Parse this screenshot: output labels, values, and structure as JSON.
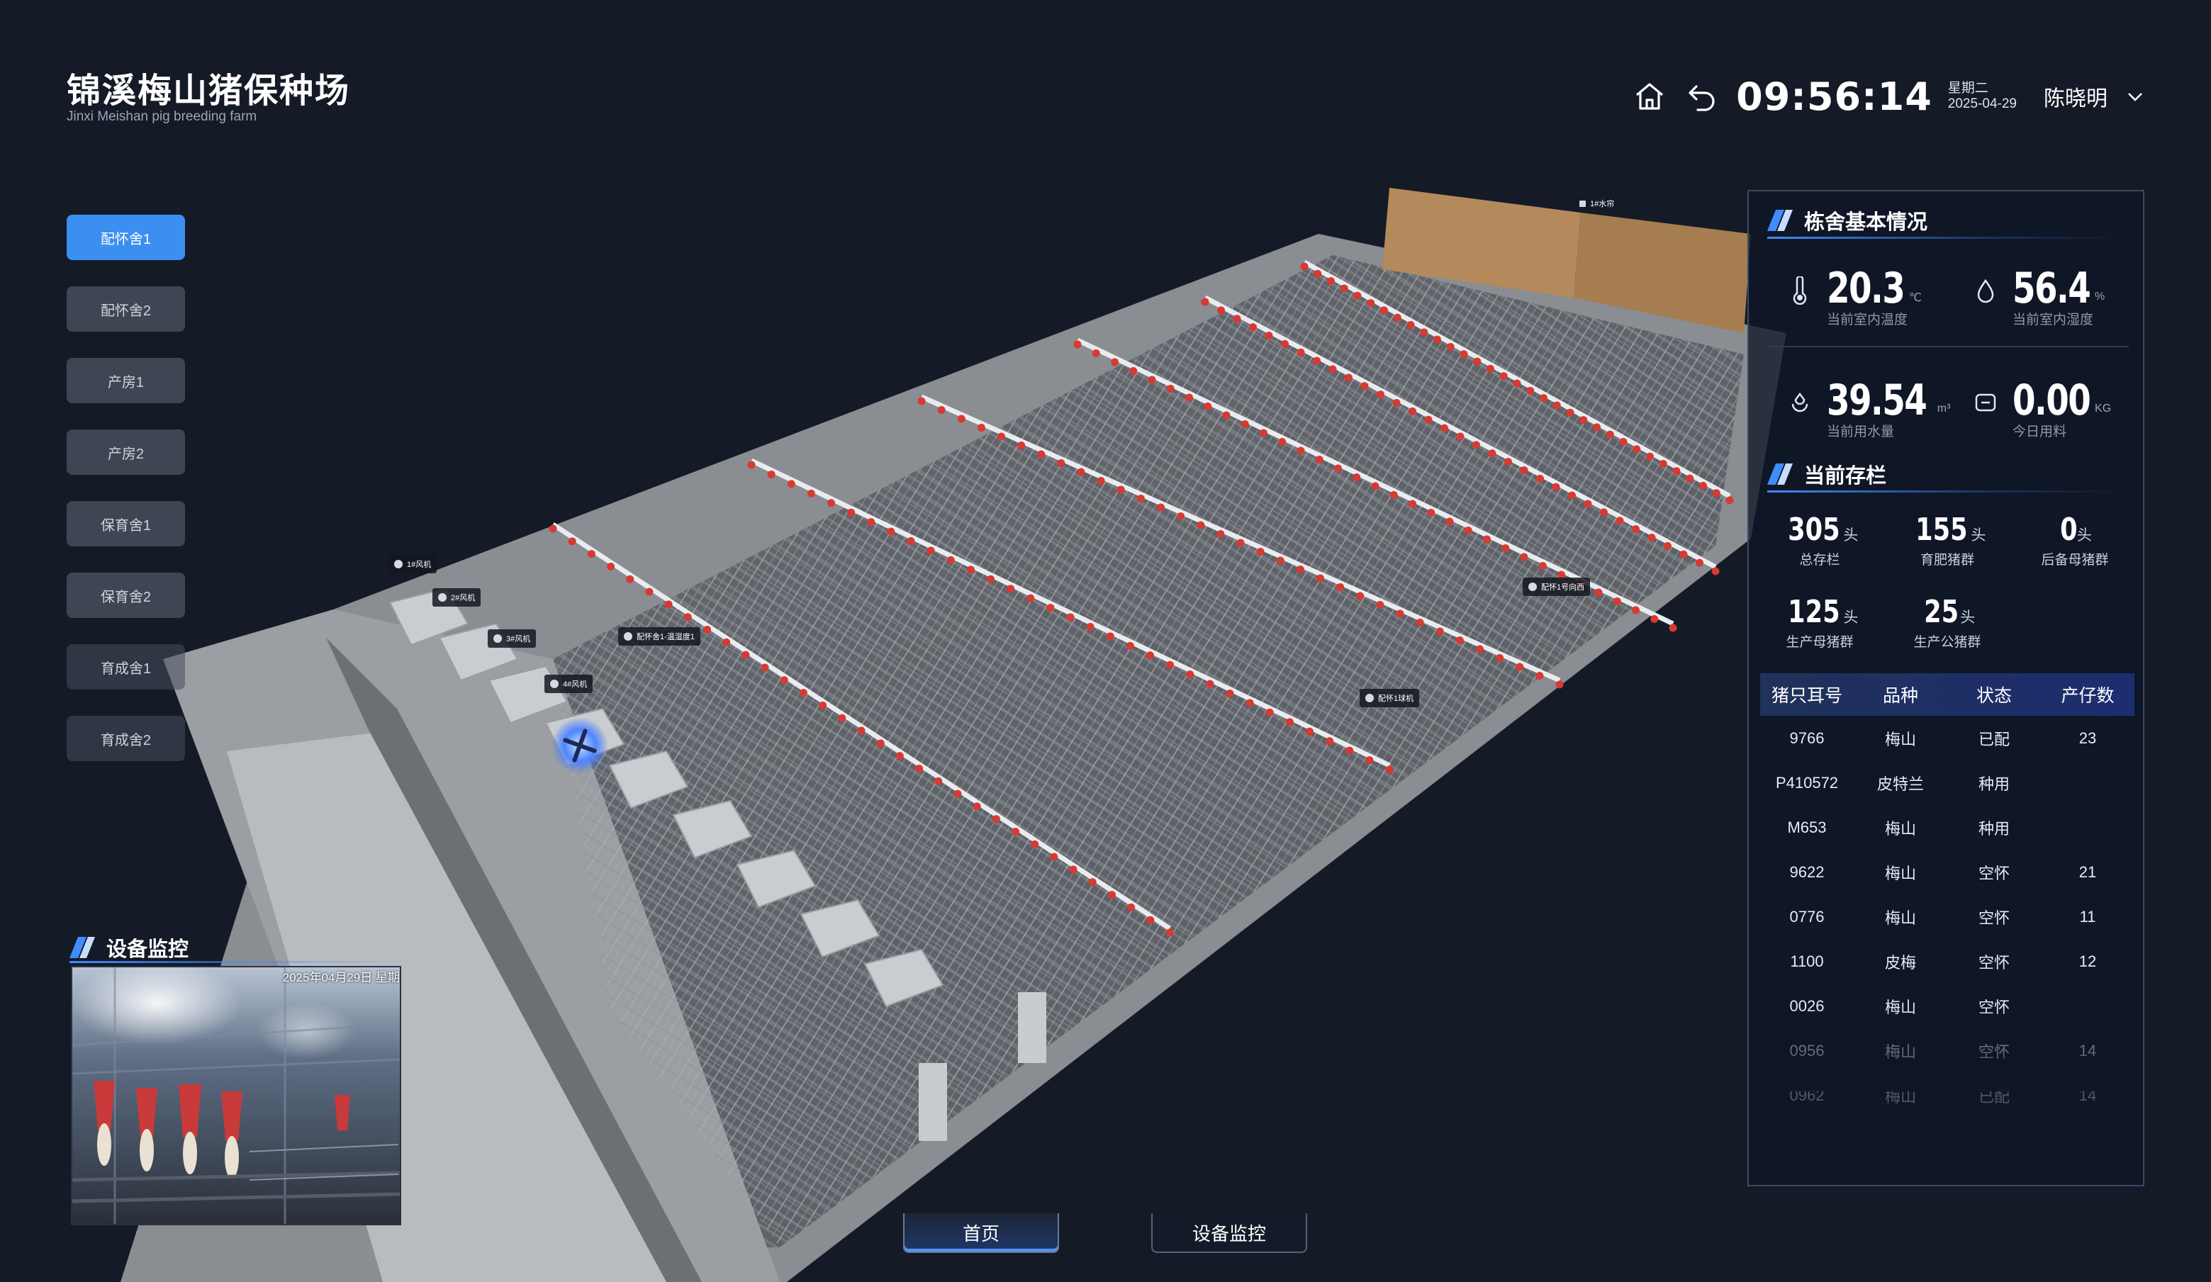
{
  "header": {
    "title": "锦溪梅山猪保种场",
    "subtitle": "Jinxi Meishan pig breeding farm",
    "time": "09:56:14",
    "weekday": "星期二",
    "date": "2025-04-29",
    "user": "陈晓明",
    "icons": [
      "home-icon",
      "back-icon",
      "chevron-down-icon"
    ]
  },
  "nav": {
    "items": [
      "配怀舍1",
      "配怀舍2",
      "产房1",
      "产房2",
      "保育舍1",
      "保育舍2",
      "育成舍1",
      "育成舍2"
    ],
    "active_index": 0
  },
  "scene": {
    "tags": [
      "1#风机",
      "2#风机",
      "3#风机",
      "4#风机",
      "配怀舍1-温湿度1",
      "配怀1号向西",
      "配怀1球机",
      "1#水帘"
    ]
  },
  "camera": {
    "title": "设备监控",
    "timestamp": "2025年04月29日  星期"
  },
  "building": {
    "title": "栋舍基本情况",
    "metrics": [
      {
        "value": "20.3",
        "unit": "℃",
        "caption": "当前室内温度",
        "icon": "thermometer-icon"
      },
      {
        "value": "56.4",
        "unit": "%",
        "caption": "当前室内湿度",
        "icon": "humidity-drop-icon"
      },
      {
        "value": "39.54",
        "unit": "m³",
        "caption": "当前用水量",
        "icon": "water-usage-icon"
      },
      {
        "value": "0.00",
        "unit": "KG",
        "caption": "今日用料",
        "icon": "feed-scale-icon"
      }
    ]
  },
  "stock": {
    "title": "当前存栏",
    "unit": "头",
    "items": [
      {
        "value": "305",
        "caption": "总存栏"
      },
      {
        "value": "155",
        "caption": "育肥猪群"
      },
      {
        "value": "0",
        "caption": "后备母猪群"
      },
      {
        "value": "125",
        "caption": "生产母猪群"
      },
      {
        "value": "25",
        "caption": "生产公猪群"
      }
    ]
  },
  "table": {
    "headers": [
      "猪只耳号",
      "品种",
      "状态",
      "产仔数"
    ],
    "rows": [
      [
        "9766",
        "梅山",
        "已配",
        "23"
      ],
      [
        "P410572",
        "皮特兰",
        "种用",
        ""
      ],
      [
        "M653",
        "梅山",
        "种用",
        ""
      ],
      [
        "9622",
        "梅山",
        "空怀",
        "21"
      ],
      [
        "0776",
        "梅山",
        "空怀",
        "11"
      ],
      [
        "1100",
        "皮梅",
        "空怀",
        "12"
      ],
      [
        "0026",
        "梅山",
        "空怀",
        ""
      ],
      [
        "0956",
        "梅山",
        "空怀",
        "14"
      ],
      [
        "0962",
        "梅山",
        "已配",
        "14"
      ]
    ]
  },
  "bottom_tabs": {
    "items": [
      "首页",
      "设备监控"
    ],
    "active_index": 0
  },
  "colors": {
    "background": "#141a26",
    "accent": "#3b8ff0",
    "crate_red": "#d63a32"
  }
}
